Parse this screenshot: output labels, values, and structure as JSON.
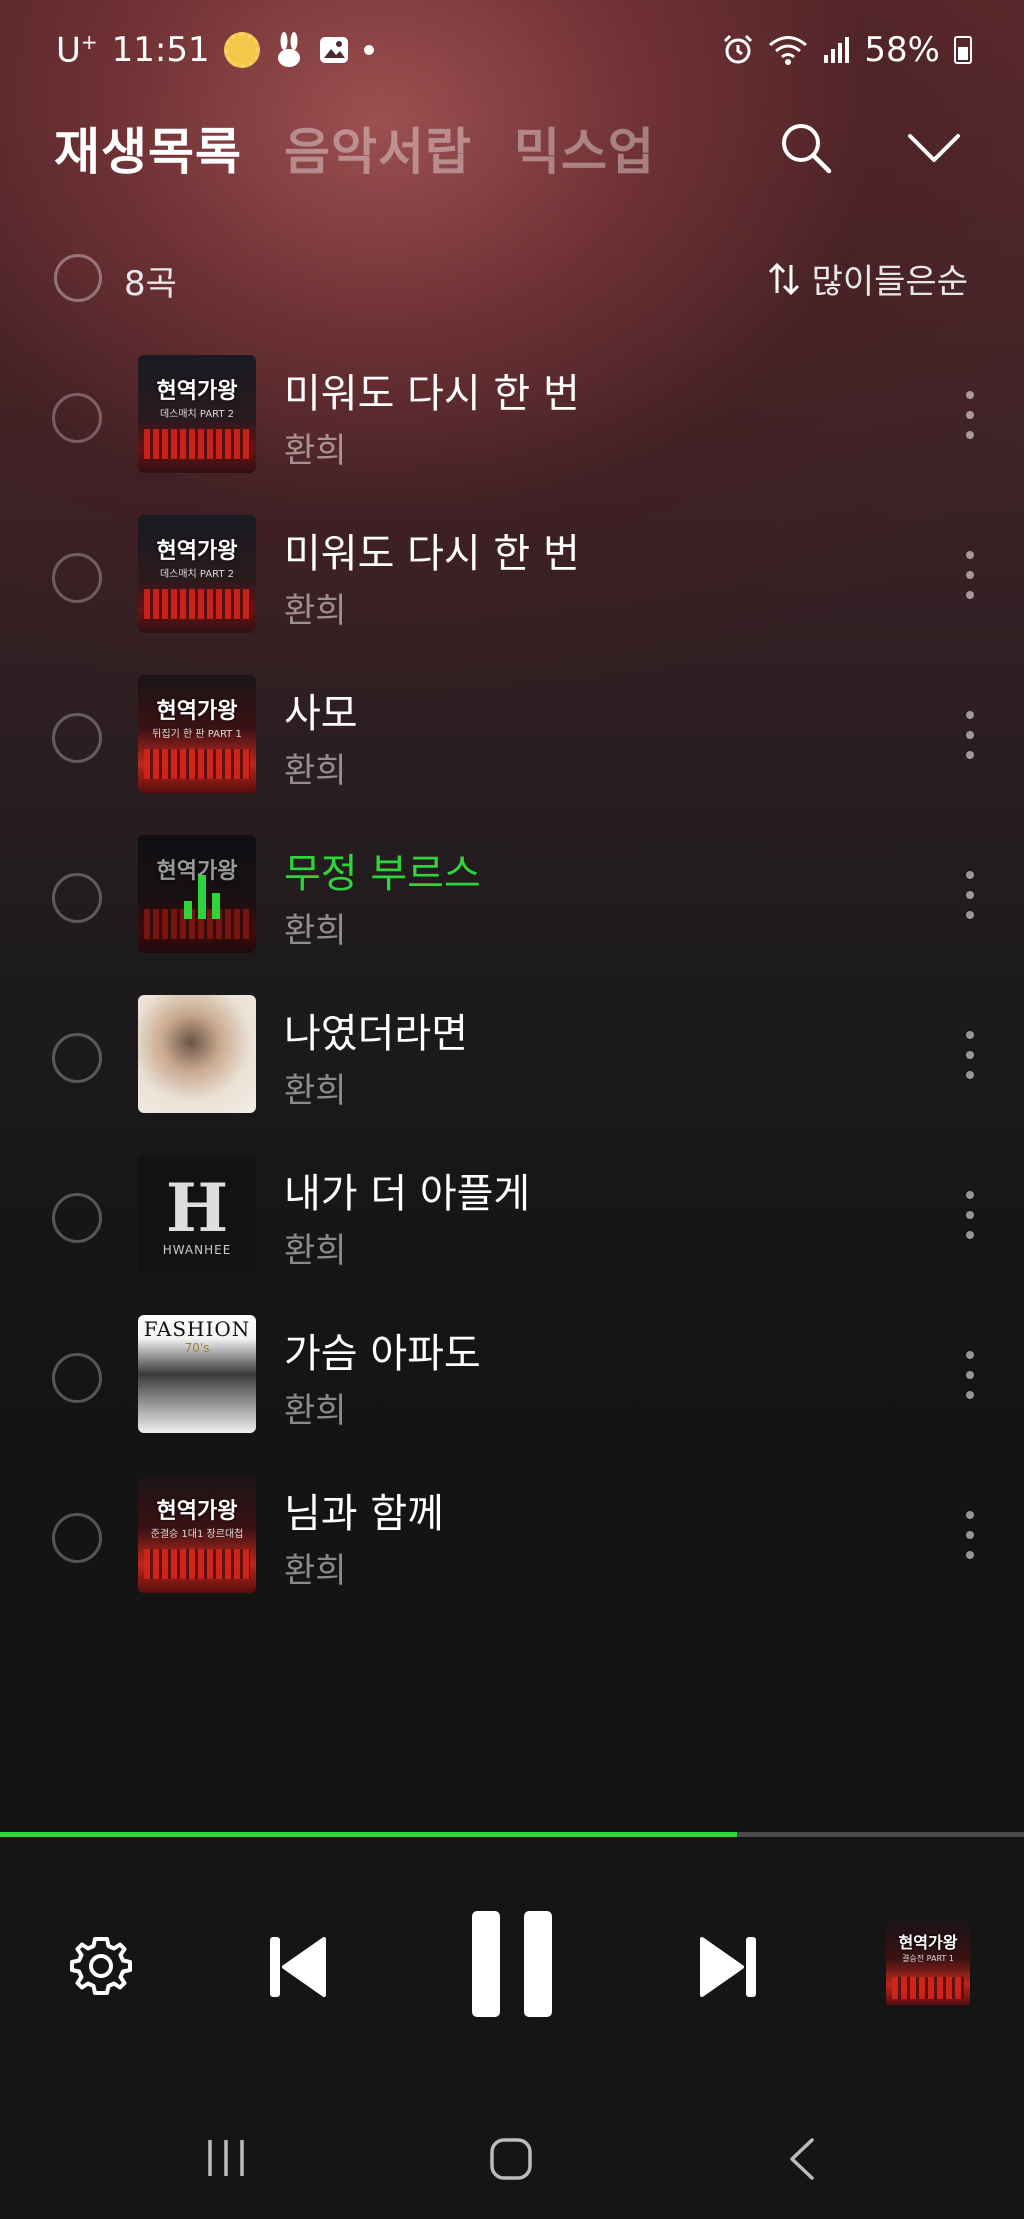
{
  "status_bar": {
    "carrier": "U",
    "carrier_sup": "+",
    "time": "11:51",
    "battery": "58%"
  },
  "header": {
    "tabs": [
      {
        "label": "재생목록",
        "active": true
      },
      {
        "label": "음악서랍",
        "active": false
      },
      {
        "label": "믹스업",
        "active": false
      }
    ]
  },
  "list_header": {
    "count": "8곡",
    "sort_label": "많이들은순"
  },
  "tracks": [
    {
      "title": "미워도 다시 한 번",
      "artist": "환희",
      "art_text": "현역가왕",
      "art_sub": "데스매치 PART 2",
      "playing": false
    },
    {
      "title": "미워도 다시 한 번",
      "artist": "환희",
      "art_text": "현역가왕",
      "art_sub": "데스매치 PART 2",
      "playing": false
    },
    {
      "title": "사모",
      "artist": "환희",
      "art_text": "현역가왕",
      "art_sub": "뒤집기 한 판 PART 1",
      "playing": false
    },
    {
      "title": "무정 부르스",
      "artist": "환희",
      "art_text": "현역가왕",
      "art_sub": "",
      "playing": true
    },
    {
      "title": "나였더라면",
      "artist": "환희",
      "playing": false
    },
    {
      "title": "내가 더 아플게",
      "artist": "환희",
      "art_letter": "H",
      "art_sub": "HWANHEE",
      "playing": false
    },
    {
      "title": "가슴 아파도",
      "artist": "환희",
      "art_text": "FASHION",
      "art_sub": "70's",
      "playing": false
    },
    {
      "title": "님과 함께",
      "artist": "환희",
      "art_text": "현역가왕",
      "art_sub": "준결승 1대1 장르대첩",
      "playing": false
    }
  ],
  "player": {
    "progress": 0.72,
    "mini_art_text": "현역가왕",
    "mini_art_sub": "결승전 PART 1"
  },
  "colors": {
    "accent": "#2fd33a",
    "player_bg": "#151515"
  }
}
